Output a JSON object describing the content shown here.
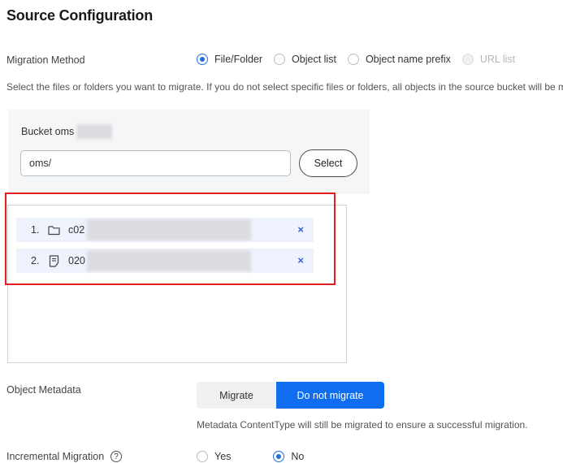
{
  "section": {
    "title": "Source Configuration"
  },
  "migration_method": {
    "label": "Migration Method",
    "options": [
      {
        "label": "File/Folder",
        "selected": true,
        "disabled": false
      },
      {
        "label": "Object list",
        "selected": false,
        "disabled": false
      },
      {
        "label": "Object name prefix",
        "selected": false,
        "disabled": false
      },
      {
        "label": "URL list",
        "selected": false,
        "disabled": true
      }
    ],
    "description": "Select the files or folders you want to migrate. If you do not select specific files or folders, all objects in the source bucket will be migra"
  },
  "bucket": {
    "label": "Bucket  oms",
    "path_value": "oms/",
    "select_label": "Select"
  },
  "selected_items": [
    {
      "index": "1.",
      "icon": "folder-icon",
      "name": "c02"
    },
    {
      "index": "2.",
      "icon": "file-icon",
      "name": "020"
    }
  ],
  "remove_symbol": "×",
  "metadata": {
    "label": "Object Metadata",
    "options": [
      "Migrate",
      "Do not migrate"
    ],
    "selected": "Do not migrate",
    "hint": "Metadata ContentType will still be migrated to ensure a successful migration."
  },
  "incremental": {
    "label": "Incremental Migration",
    "help": "?",
    "options": [
      {
        "label": "Yes",
        "selected": false
      },
      {
        "label": "No",
        "selected": true
      }
    ]
  },
  "colors": {
    "accent": "#0f6df0",
    "highlight_box": "#e31d1c",
    "row_bg": "#eef2fc"
  }
}
